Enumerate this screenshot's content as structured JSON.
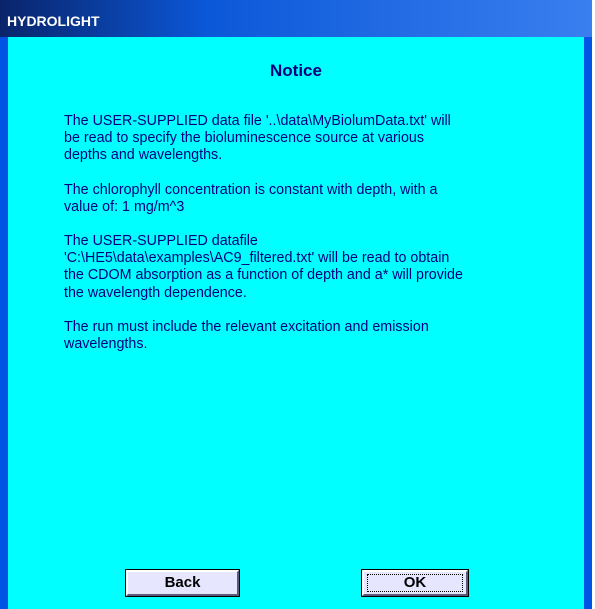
{
  "window": {
    "title": "HYDROLIGHT"
  },
  "dialog": {
    "heading": "Notice",
    "paragraphs": [
      "The USER-SUPPLIED data file '..\\data\\MyBiolumData.txt' will\nbe read to specify the bioluminescence source at various\ndepths and wavelengths.",
      "The chlorophyll concentration is constant with depth, with a\nvalue of:  1 mg/m^3",
      "The USER-SUPPLIED datafile\n'C:\\HE5\\data\\examples\\AC9_filtered.txt' will be read to obtain\nthe CDOM absorption as a function of depth and a* will provide\nthe wavelength dependence.",
      "The run must include the relevant excitation and emission\nwavelengths."
    ]
  },
  "buttons": {
    "back_label": "Back",
    "ok_label": "OK"
  },
  "colors": {
    "window_frame": "#0054e3",
    "client_background": "#00ffff",
    "text": "#000080",
    "button_face": "#e6e6ff"
  }
}
